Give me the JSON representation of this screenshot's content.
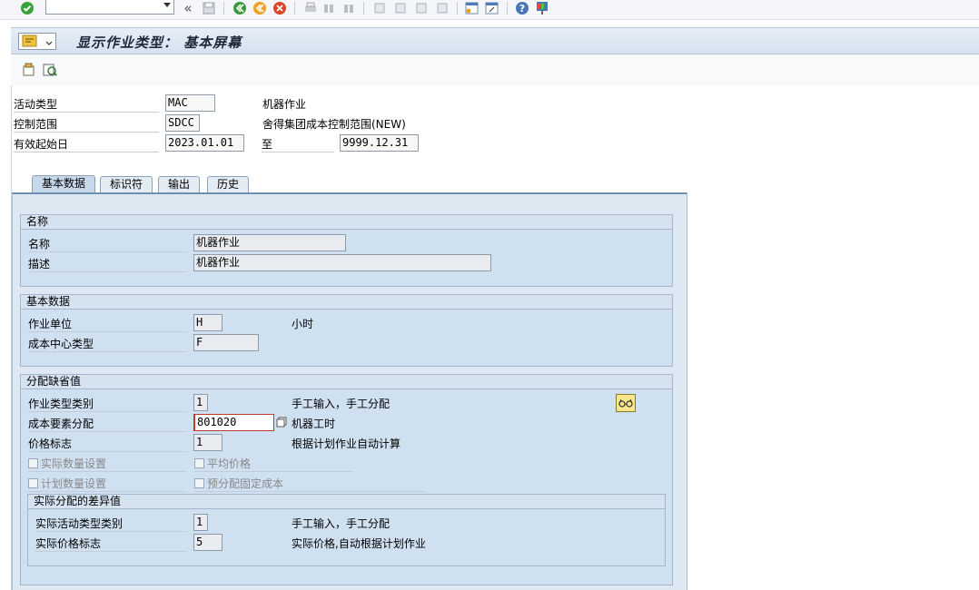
{
  "header": {
    "title": "显示作业类型：  基本屏幕",
    "fields": [
      {
        "label": "活动类型",
        "value": "MAC",
        "desc": "机器作业"
      },
      {
        "label": "控制范围",
        "value": "SDCC",
        "desc": "舍得集团成本控制范围(NEW)"
      },
      {
        "label": "有效起始日",
        "value": "2023.01.01",
        "to_label": "至",
        "to_value": "9999.12.31"
      }
    ]
  },
  "toolbar": {
    "command_value": "",
    "back_glyph": "«"
  },
  "tabs": [
    "基本数据",
    "标识符",
    "输出",
    "历史"
  ],
  "groups": {
    "name": {
      "title": "名称",
      "rows": [
        {
          "label": "名称",
          "value": "机器作业"
        },
        {
          "label": "描述",
          "value": "机器作业"
        }
      ]
    },
    "basic": {
      "title": "基本数据",
      "rows": [
        {
          "label": "作业单位",
          "value": "H",
          "desc": "小时"
        },
        {
          "label": "成本中心类型",
          "value": "F"
        }
      ]
    },
    "alloc": {
      "title": "分配缺省值",
      "rows": [
        {
          "label": "作业类型类别",
          "value": "1",
          "desc": "手工输入，手工分配"
        },
        {
          "label": "成本要素分配",
          "value": "801020",
          "desc": "机器工时"
        },
        {
          "label": "价格标志",
          "value": "1",
          "desc": "根据计划作业自动计算"
        }
      ],
      "checks": [
        "实际数量设置",
        "平均价格",
        "计划数量设置",
        "预分配固定成本"
      ]
    },
    "variance": {
      "title": "实际分配的差异值",
      "rows": [
        {
          "label": "实际活动类型类别",
          "value": "1",
          "desc": "手工输入，手工分配"
        },
        {
          "label": "实际价格标志",
          "value": "5",
          "desc": "实际价格,自动根据计划作业"
        }
      ]
    }
  },
  "colors": {
    "accent": "#6f8fb1",
    "panel": "#dde8f3",
    "group": "#cfe0f1",
    "focus": "#c0392b"
  }
}
